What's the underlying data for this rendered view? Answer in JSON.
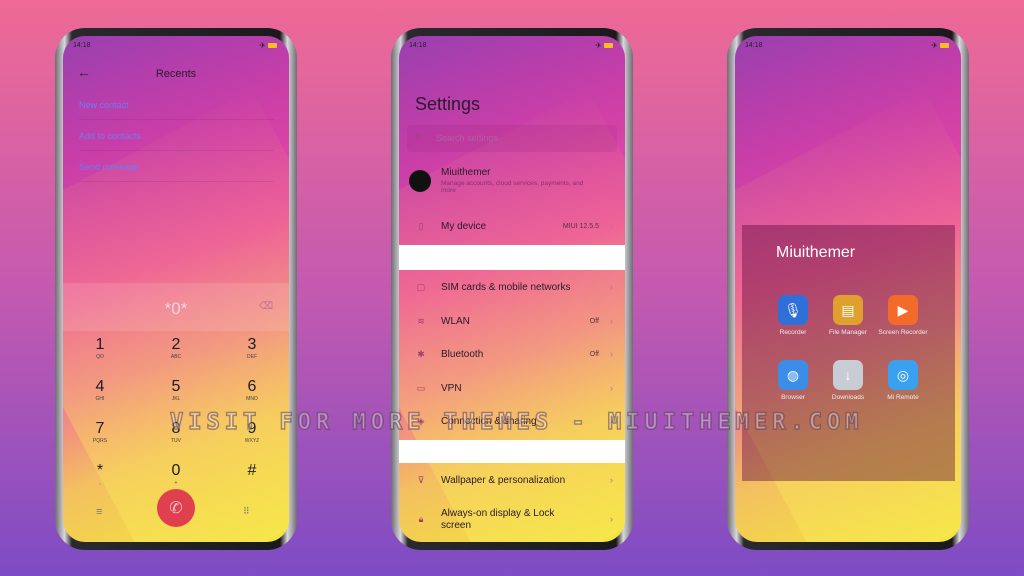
{
  "watermark": "VISIT FOR MORE THEMES - MIUITHEMER.COM",
  "status_time": "14:18",
  "dialer": {
    "title": "Recents",
    "links": [
      "New contact",
      "Add to contacts",
      "Send message"
    ],
    "input": "*0*",
    "keys": [
      {
        "d": "1",
        "l": "QO"
      },
      {
        "d": "2",
        "l": "ABC"
      },
      {
        "d": "3",
        "l": "DEF"
      },
      {
        "d": "4",
        "l": "GHI"
      },
      {
        "d": "5",
        "l": "JKL"
      },
      {
        "d": "6",
        "l": "MNO"
      },
      {
        "d": "7",
        "l": "PQRS"
      },
      {
        "d": "8",
        "l": "TUV"
      },
      {
        "d": "9",
        "l": "WXYZ"
      },
      {
        "d": "*",
        "l": ","
      },
      {
        "d": "0",
        "l": "+"
      },
      {
        "d": "#",
        "l": ""
      }
    ]
  },
  "settings": {
    "title": "Settings",
    "search_placeholder": "Search settings",
    "account": {
      "name": "Miuithemer",
      "desc": "Manage accounts, cloud services, payments, and more"
    },
    "my_device": {
      "label": "My device",
      "value": "MIUI 12.5.5"
    },
    "items": [
      {
        "label": "SIM cards & mobile networks",
        "value": ""
      },
      {
        "label": "WLAN",
        "value": "Off"
      },
      {
        "label": "Bluetooth",
        "value": "Off"
      },
      {
        "label": "VPN",
        "value": ""
      },
      {
        "label": "Connection & sharing",
        "value": ""
      }
    ],
    "items2": [
      {
        "label": "Wallpaper & personalization"
      },
      {
        "label": "Always-on display & Lock screen"
      }
    ]
  },
  "folder": {
    "title": "Miuithemer",
    "apps": [
      {
        "label": "Recorder",
        "color": "#2f6fd8"
      },
      {
        "label": "File Manager",
        "color": "#e0a030"
      },
      {
        "label": "Screen Recorder",
        "color": "#f46a2a"
      },
      {
        "label": "Browser",
        "color": "#3a8ee8"
      },
      {
        "label": "Downloads",
        "color": "#c8ccd4"
      },
      {
        "label": "Mi Remote",
        "color": "#3aa0f0"
      }
    ]
  }
}
